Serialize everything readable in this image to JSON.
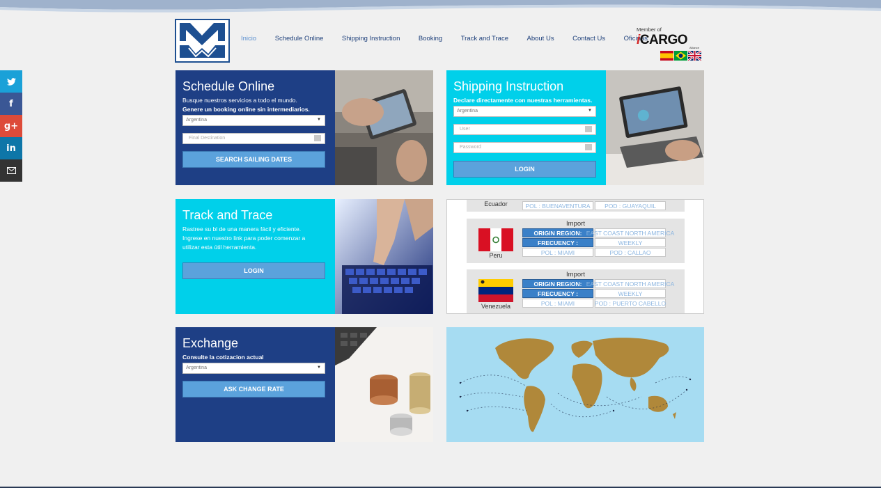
{
  "nav": {
    "items": [
      "Inicio",
      "Schedule Online",
      "Shipping Instruction",
      "Booking",
      "Track and Trace",
      "About Us",
      "Contact Us",
      "Oficinas"
    ]
  },
  "member": {
    "label": "Member of",
    "brand_i": "i",
    "brand_rest": "CARGO",
    "alliance": "Alliance"
  },
  "social": {
    "icons": [
      "twitter-icon",
      "facebook-icon",
      "google-plus-icon",
      "linkedin-icon",
      "email-icon"
    ],
    "colors": [
      "#1aa1d8",
      "#3a5795",
      "#dd4b39",
      "#0e76a8",
      "#333333"
    ]
  },
  "schedule": {
    "title": "Schedule Online",
    "desc1": "Busque nuestros servicios a todo el mundo.",
    "desc2": "Genere un booking online sin intermediarios.",
    "origin": "Argentina",
    "destination_placeholder": "Final Destination",
    "button": "SEARCH SAILING DATES"
  },
  "shipping": {
    "title": "Shipping Instruction",
    "desc": "Declare directamente con nuestras herramientas.",
    "country": "Argentina",
    "user_placeholder": "User",
    "password_placeholder": "Password",
    "button": "LOGIN"
  },
  "track": {
    "title": "Track and Trace",
    "desc1": "Rastree su bl de una manera fácil y eficiente.",
    "desc2": "Ingrese en nuestro link para poder comenzar a",
    "desc3": "utilizar esta útil herramienta.",
    "button": "LOGIN"
  },
  "exchange": {
    "title": "Exchange",
    "desc": "Consulte la cotizacion actual",
    "country": "Argentina",
    "button": "ASK CHANGE RATE"
  },
  "routes": {
    "top": {
      "country": "Ecuador",
      "pol": "POL : BUENAVENTURA",
      "pod": "POD : GUAYAQUIL"
    },
    "items": [
      {
        "type": "Import",
        "country": "Peru",
        "origin_label": "ORIGIN REGION:",
        "origin": "EAST COAST NORTH AMERICA",
        "freq_label": "FRECUENCY :",
        "freq": "WEEKLY",
        "pol": "POL : MIAMI",
        "pod": "POD : CALLAO"
      },
      {
        "type": "Import",
        "country": "Venezuela",
        "origin_label": "ORIGIN REGION:",
        "origin": "EAST COAST NORTH AMERICA",
        "freq_label": "FRECUENCY :",
        "freq": "WEEKLY",
        "pol": "POL : MIAMI",
        "pod": "POD : PUERTO CABELLO"
      }
    ]
  },
  "colors": {
    "navy": "#1e3f85",
    "cyan": "#00d0ea",
    "button": "#5ba2dc",
    "map_bg": "#a6dcf2",
    "land": "#b0883a"
  }
}
